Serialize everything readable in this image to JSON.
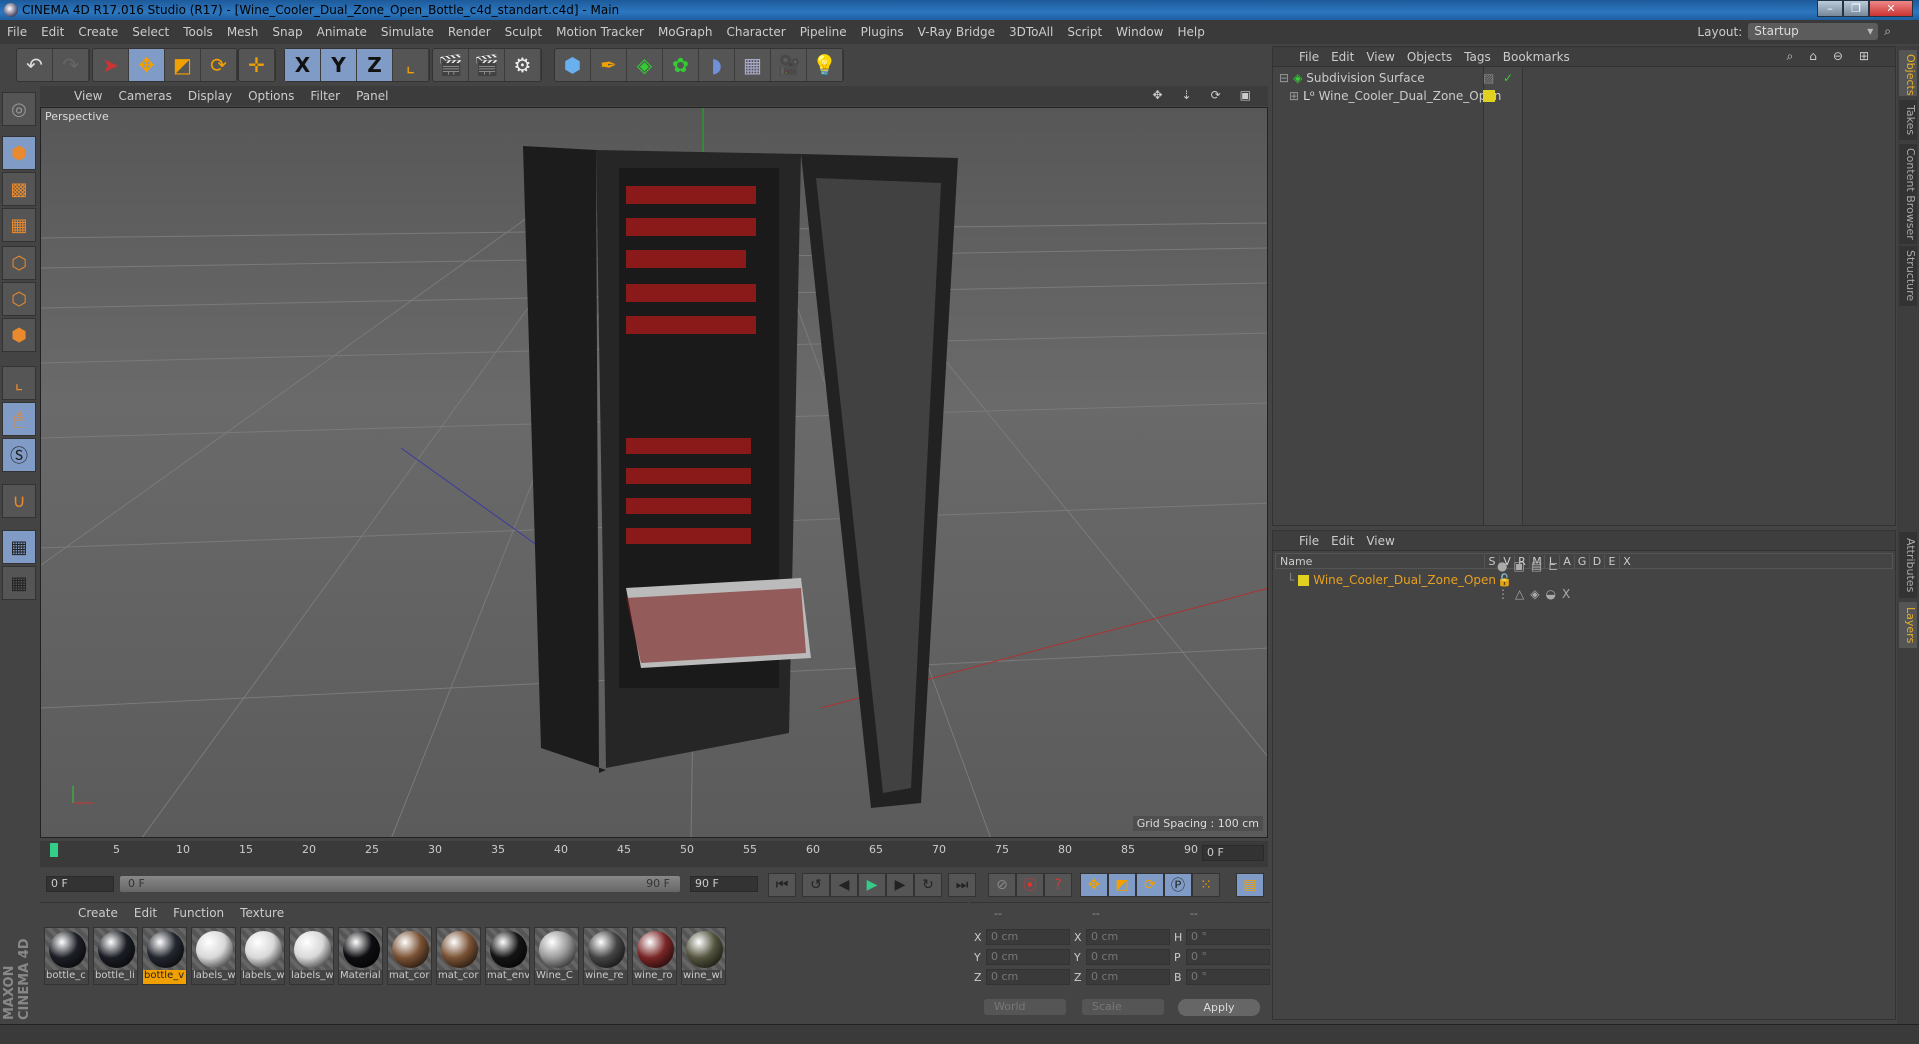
{
  "window": {
    "title": "CINEMA 4D R17.016 Studio (R17) - [Wine_Cooler_Dual_Zone_Open_Bottle_c4d_standart.c4d] - Main",
    "controls": [
      "minimize",
      "maximize",
      "close"
    ]
  },
  "menubar": {
    "items": [
      "File",
      "Edit",
      "Create",
      "Select",
      "Tools",
      "Mesh",
      "Snap",
      "Animate",
      "Simulate",
      "Render",
      "Sculpt",
      "Motion Tracker",
      "MoGraph",
      "Character",
      "Pipeline",
      "Plugins",
      "V-Ray Bridge",
      "3DToAll",
      "Script",
      "Window",
      "Help"
    ]
  },
  "layout": {
    "label": "Layout:",
    "value": "Startup"
  },
  "toolbar": {
    "groups": [
      [
        "undo-icon",
        "redo-icon"
      ],
      [
        "select-arrow-icon",
        "move-icon",
        "scale-icon",
        "rotate-icon"
      ],
      [
        "move-alt-icon"
      ],
      [
        "x-axis-icon",
        "y-axis-icon",
        "z-axis-icon",
        "coordinate-system-icon"
      ],
      [
        "render-view-icon",
        "render-picture-viewer-icon",
        "render-settings-icon"
      ],
      [
        "cube-icon",
        "pen-spline-icon",
        "subdivision-icon",
        "cloner-icon",
        "deformer-icon",
        "floor-icon",
        "camera-icon",
        "light-icon"
      ]
    ],
    "axis_labels": [
      "X",
      "Y",
      "Z"
    ]
  },
  "left_toolbar": [
    "make-editable-icon",
    "model-mode-icon",
    "texture-mode-icon",
    "workplane-icon",
    "points-mode-icon",
    "edges-mode-icon",
    "polygons-mode-icon",
    "axis-mode-icon",
    "tweak-mode-icon",
    "solo-icon",
    "snap-icon",
    "locked-workplane-icon",
    "planar-workplane-icon"
  ],
  "viewport": {
    "menu": [
      "View",
      "Cameras",
      "Display",
      "Options",
      "Filter",
      "Panel"
    ],
    "label": "Perspective",
    "grid_spacing": "Grid Spacing : 100 cm"
  },
  "timeline": {
    "ticks": [
      "0",
      "5",
      "10",
      "15",
      "20",
      "25",
      "30",
      "35",
      "40",
      "45",
      "50",
      "55",
      "60",
      "65",
      "70",
      "75",
      "80",
      "85",
      "90"
    ],
    "current_frame": "0 F"
  },
  "transport": {
    "start_field": "0 F",
    "range_start": "0 F",
    "range_end": "90 F",
    "end_field": "90 F"
  },
  "materials": {
    "menu": [
      "Create",
      "Edit",
      "Function",
      "Texture"
    ],
    "items": [
      {
        "name": "bottle_c",
        "color": "#1c1f26"
      },
      {
        "name": "bottle_li",
        "color": "#1a1d24"
      },
      {
        "name": "bottle_v",
        "color": "#22262e",
        "selected": true
      },
      {
        "name": "labels_w",
        "color": "#d8d8d8"
      },
      {
        "name": "labels_w",
        "color": "#d8d8d8"
      },
      {
        "name": "labels_w",
        "color": "#d8d8d8"
      },
      {
        "name": "Material",
        "color": "#0e0e12"
      },
      {
        "name": "mat_cor",
        "color": "#7a5234"
      },
      {
        "name": "mat_cor",
        "color": "#7a5234"
      },
      {
        "name": "mat_env",
        "color": "#141414"
      },
      {
        "name": "Wine_C",
        "color": "#9a9a9a"
      },
      {
        "name": "wine_re",
        "color": "#444"
      },
      {
        "name": "wine_ro",
        "color": "#7a2626"
      },
      {
        "name": "wine_wl",
        "color": "#555540"
      }
    ]
  },
  "coordinates": {
    "headers": [
      "--",
      "--",
      "--"
    ],
    "rows": [
      {
        "l1": "X",
        "v1": "0 cm",
        "l2": "X",
        "v2": "0 cm",
        "l3": "H",
        "v3": "0 °"
      },
      {
        "l1": "Y",
        "v1": "0 cm",
        "l2": "Y",
        "v2": "0 cm",
        "l3": "P",
        "v3": "0 °"
      },
      {
        "l1": "Z",
        "v1": "0 cm",
        "l2": "Z",
        "v2": "0 cm",
        "l3": "B",
        "v3": "0 °"
      }
    ],
    "mode": "World",
    "transform": "Scale",
    "apply": "Apply"
  },
  "objects": {
    "menu": [
      "File",
      "Edit",
      "View",
      "Objects",
      "Tags",
      "Bookmarks"
    ],
    "items": [
      {
        "name": "Subdivision Surface",
        "icon": "subdivision-icon"
      },
      {
        "name": "Wine_Cooler_Dual_Zone_Open",
        "icon": "null-object-icon",
        "color": "#e0d020"
      }
    ]
  },
  "layers": {
    "menu": [
      "File",
      "Edit",
      "View"
    ],
    "columns": [
      "Name",
      "S",
      "V",
      "R",
      "M",
      "L",
      "A",
      "G",
      "D",
      "E",
      "X"
    ],
    "items": [
      {
        "name": "Wine_Cooler_Dual_Zone_Open",
        "color": "#e0d020"
      }
    ]
  },
  "side_tabs": [
    "Objects",
    "Takes",
    "Content Browser",
    "Structure",
    "Attributes",
    "Layers"
  ],
  "brand": "MAXON CINEMA 4D",
  "colors": {
    "accent": "#f0a000",
    "selected_blue": "#7f9bc6",
    "layer_text": "#e8a020"
  }
}
